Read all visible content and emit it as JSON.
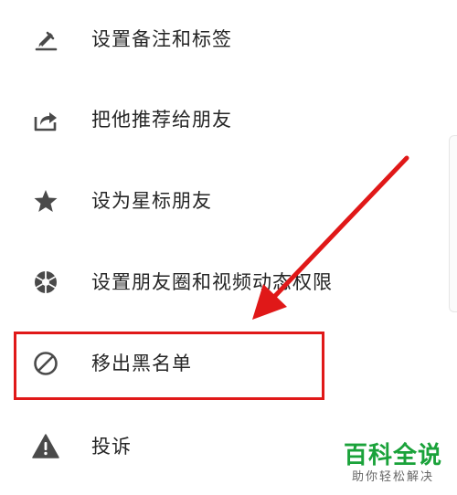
{
  "menu": {
    "items": [
      {
        "label": "设置备注和标签",
        "icon": "edit-pencil-icon"
      },
      {
        "label": "把他推荐给朋友",
        "icon": "share-icon"
      },
      {
        "label": "设为星标朋友",
        "icon": "star-icon"
      },
      {
        "label": "设置朋友圈和视频动态权限",
        "icon": "aperture-icon"
      },
      {
        "label": "移出黑名单",
        "icon": "blocked-icon"
      },
      {
        "label": "投诉",
        "icon": "warning-icon"
      }
    ]
  },
  "annotation": {
    "highlight_color": "#e01818",
    "highlight_target": "移出黑名单"
  },
  "watermark": {
    "title": "百科全说",
    "subtitle": "助你轻松解决"
  },
  "colors": {
    "text": "#262626",
    "icon": "#4a4a4a",
    "watermark_green": "#1aa23a"
  }
}
